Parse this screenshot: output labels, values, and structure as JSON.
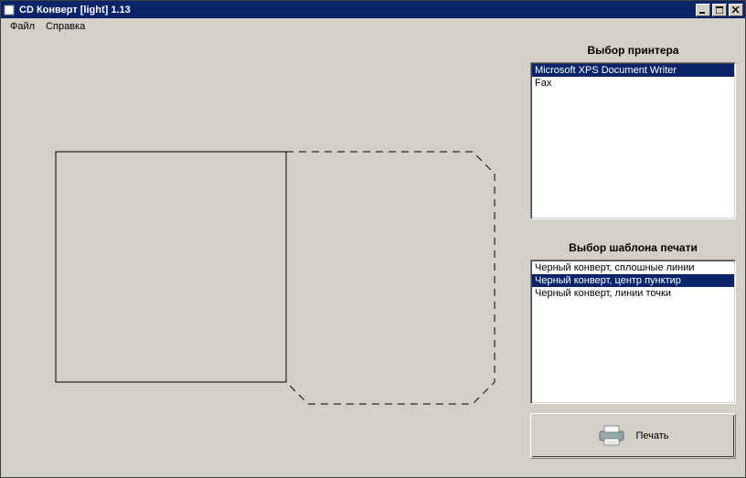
{
  "window": {
    "title": "CD Конверт [light] 1.13"
  },
  "menu": {
    "file": "Файл",
    "help": "Справка"
  },
  "printer": {
    "header": "Выбор принтера",
    "items": [
      {
        "label": "Microsoft XPS Document Writer",
        "selected": true
      },
      {
        "label": "Fax",
        "selected": false
      }
    ]
  },
  "template": {
    "header": "Выбор шаблона печати",
    "items": [
      {
        "label": "Черный конверт, сплошные линии",
        "selected": false
      },
      {
        "label": "Черный конверт, центр пунктир",
        "selected": true
      },
      {
        "label": "Черный конверт, линии точки",
        "selected": false
      }
    ]
  },
  "print_button": "Печать"
}
